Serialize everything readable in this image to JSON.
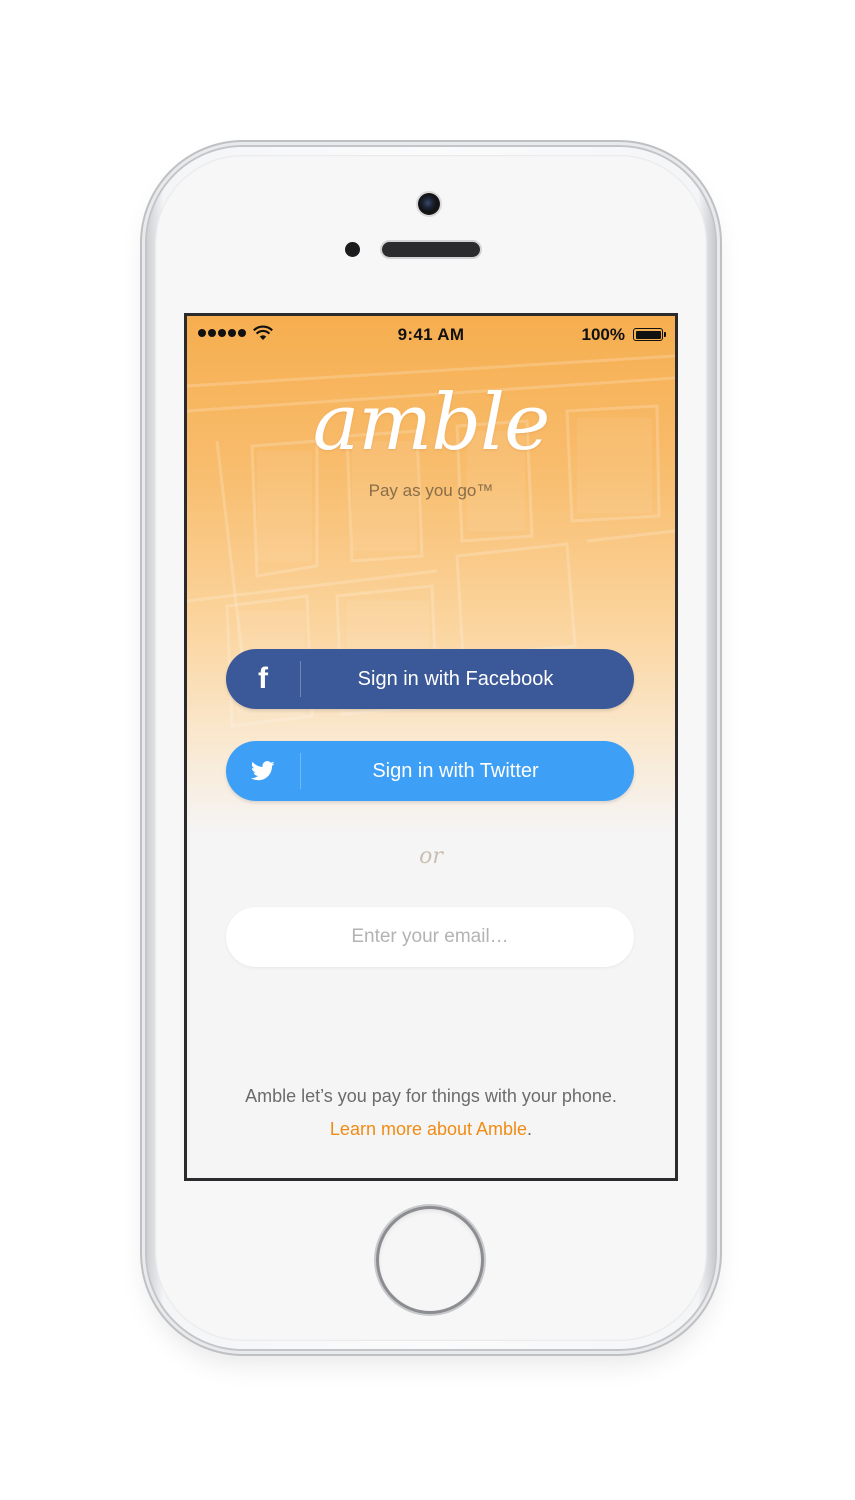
{
  "status_bar": {
    "time": "9:41 AM",
    "battery_percent": "100%",
    "signal_bars": 5,
    "icons": [
      "signal-dots-icon",
      "wifi-icon",
      "battery-icon"
    ]
  },
  "branding": {
    "logo": "amble",
    "tagline": "Pay as you go™"
  },
  "facebook_button": {
    "label": "Sign in with Facebook",
    "icon": "facebook-icon",
    "color": "#3b5998"
  },
  "twitter_button": {
    "label": "Sign in with Twitter",
    "icon": "twitter-icon",
    "color": "#3d9ff5"
  },
  "divider": {
    "text": "or"
  },
  "email_field": {
    "value": "",
    "placeholder": "Enter your email…"
  },
  "footer": {
    "text": "Amble let’s you pay for things with your phone.",
    "text_before_link": "Amble let’s you pay for things with your phone.",
    "link_label": "Learn more about Amble",
    "text_after_link": "."
  },
  "colors": {
    "accent": "#f08c14",
    "hero_top": "#f6ae4f",
    "screen_background": "#f5f5f6"
  }
}
